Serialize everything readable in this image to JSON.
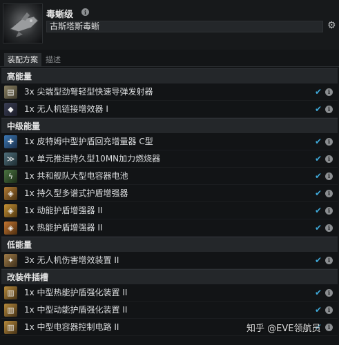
{
  "header": {
    "ship_name": "毒蜥级",
    "fit_name": "古斯塔斯毒蜥"
  },
  "tabs": [
    {
      "label": "装配方案",
      "active": true
    },
    {
      "label": "描述",
      "active": false
    }
  ],
  "sections": [
    {
      "title": "高能量",
      "items": [
        {
          "text": "3x 尖端型劲弩轻型快速导弹发射器",
          "icon": "missile-launcher-icon"
        },
        {
          "text": "1x 无人机链接增效器 I",
          "icon": "drone-link-icon"
        }
      ]
    },
    {
      "title": "中级能量",
      "items": [
        {
          "text": "1x 皮特姆中型护盾回充增量器 C型",
          "icon": "shield-booster-icon"
        },
        {
          "text": "1x 单元推进持久型10MN加力燃烧器",
          "icon": "afterburner-icon"
        },
        {
          "text": "1x 共和舰队大型电容器电池",
          "icon": "cap-battery-icon"
        },
        {
          "text": "1x 持久型多谱式护盾增强器",
          "icon": "shield-hardener-icon"
        },
        {
          "text": "1x 动能护盾增强器 II",
          "icon": "kinetic-hardener-icon"
        },
        {
          "text": "1x 热能护盾增强器 II",
          "icon": "thermal-hardener-icon"
        }
      ]
    },
    {
      "title": "低能量",
      "items": [
        {
          "text": "3x 无人机伤害增效装置 II",
          "icon": "drone-damage-icon"
        }
      ]
    },
    {
      "title": "改装件插槽",
      "items": [
        {
          "text": "1x 中型热能护盾强化装置 II",
          "icon": "rig-thermal-icon"
        },
        {
          "text": "1x 中型动能护盾强化装置 II",
          "icon": "rig-kinetic-icon"
        },
        {
          "text": "1x 中型电容器控制电路 II",
          "icon": "rig-cap-icon"
        }
      ]
    }
  ],
  "watermark": "知乎 @EVE领航员",
  "colors": {
    "accent_check": "#3fa9d9",
    "background": "#131517",
    "section_header": "#24272a"
  }
}
